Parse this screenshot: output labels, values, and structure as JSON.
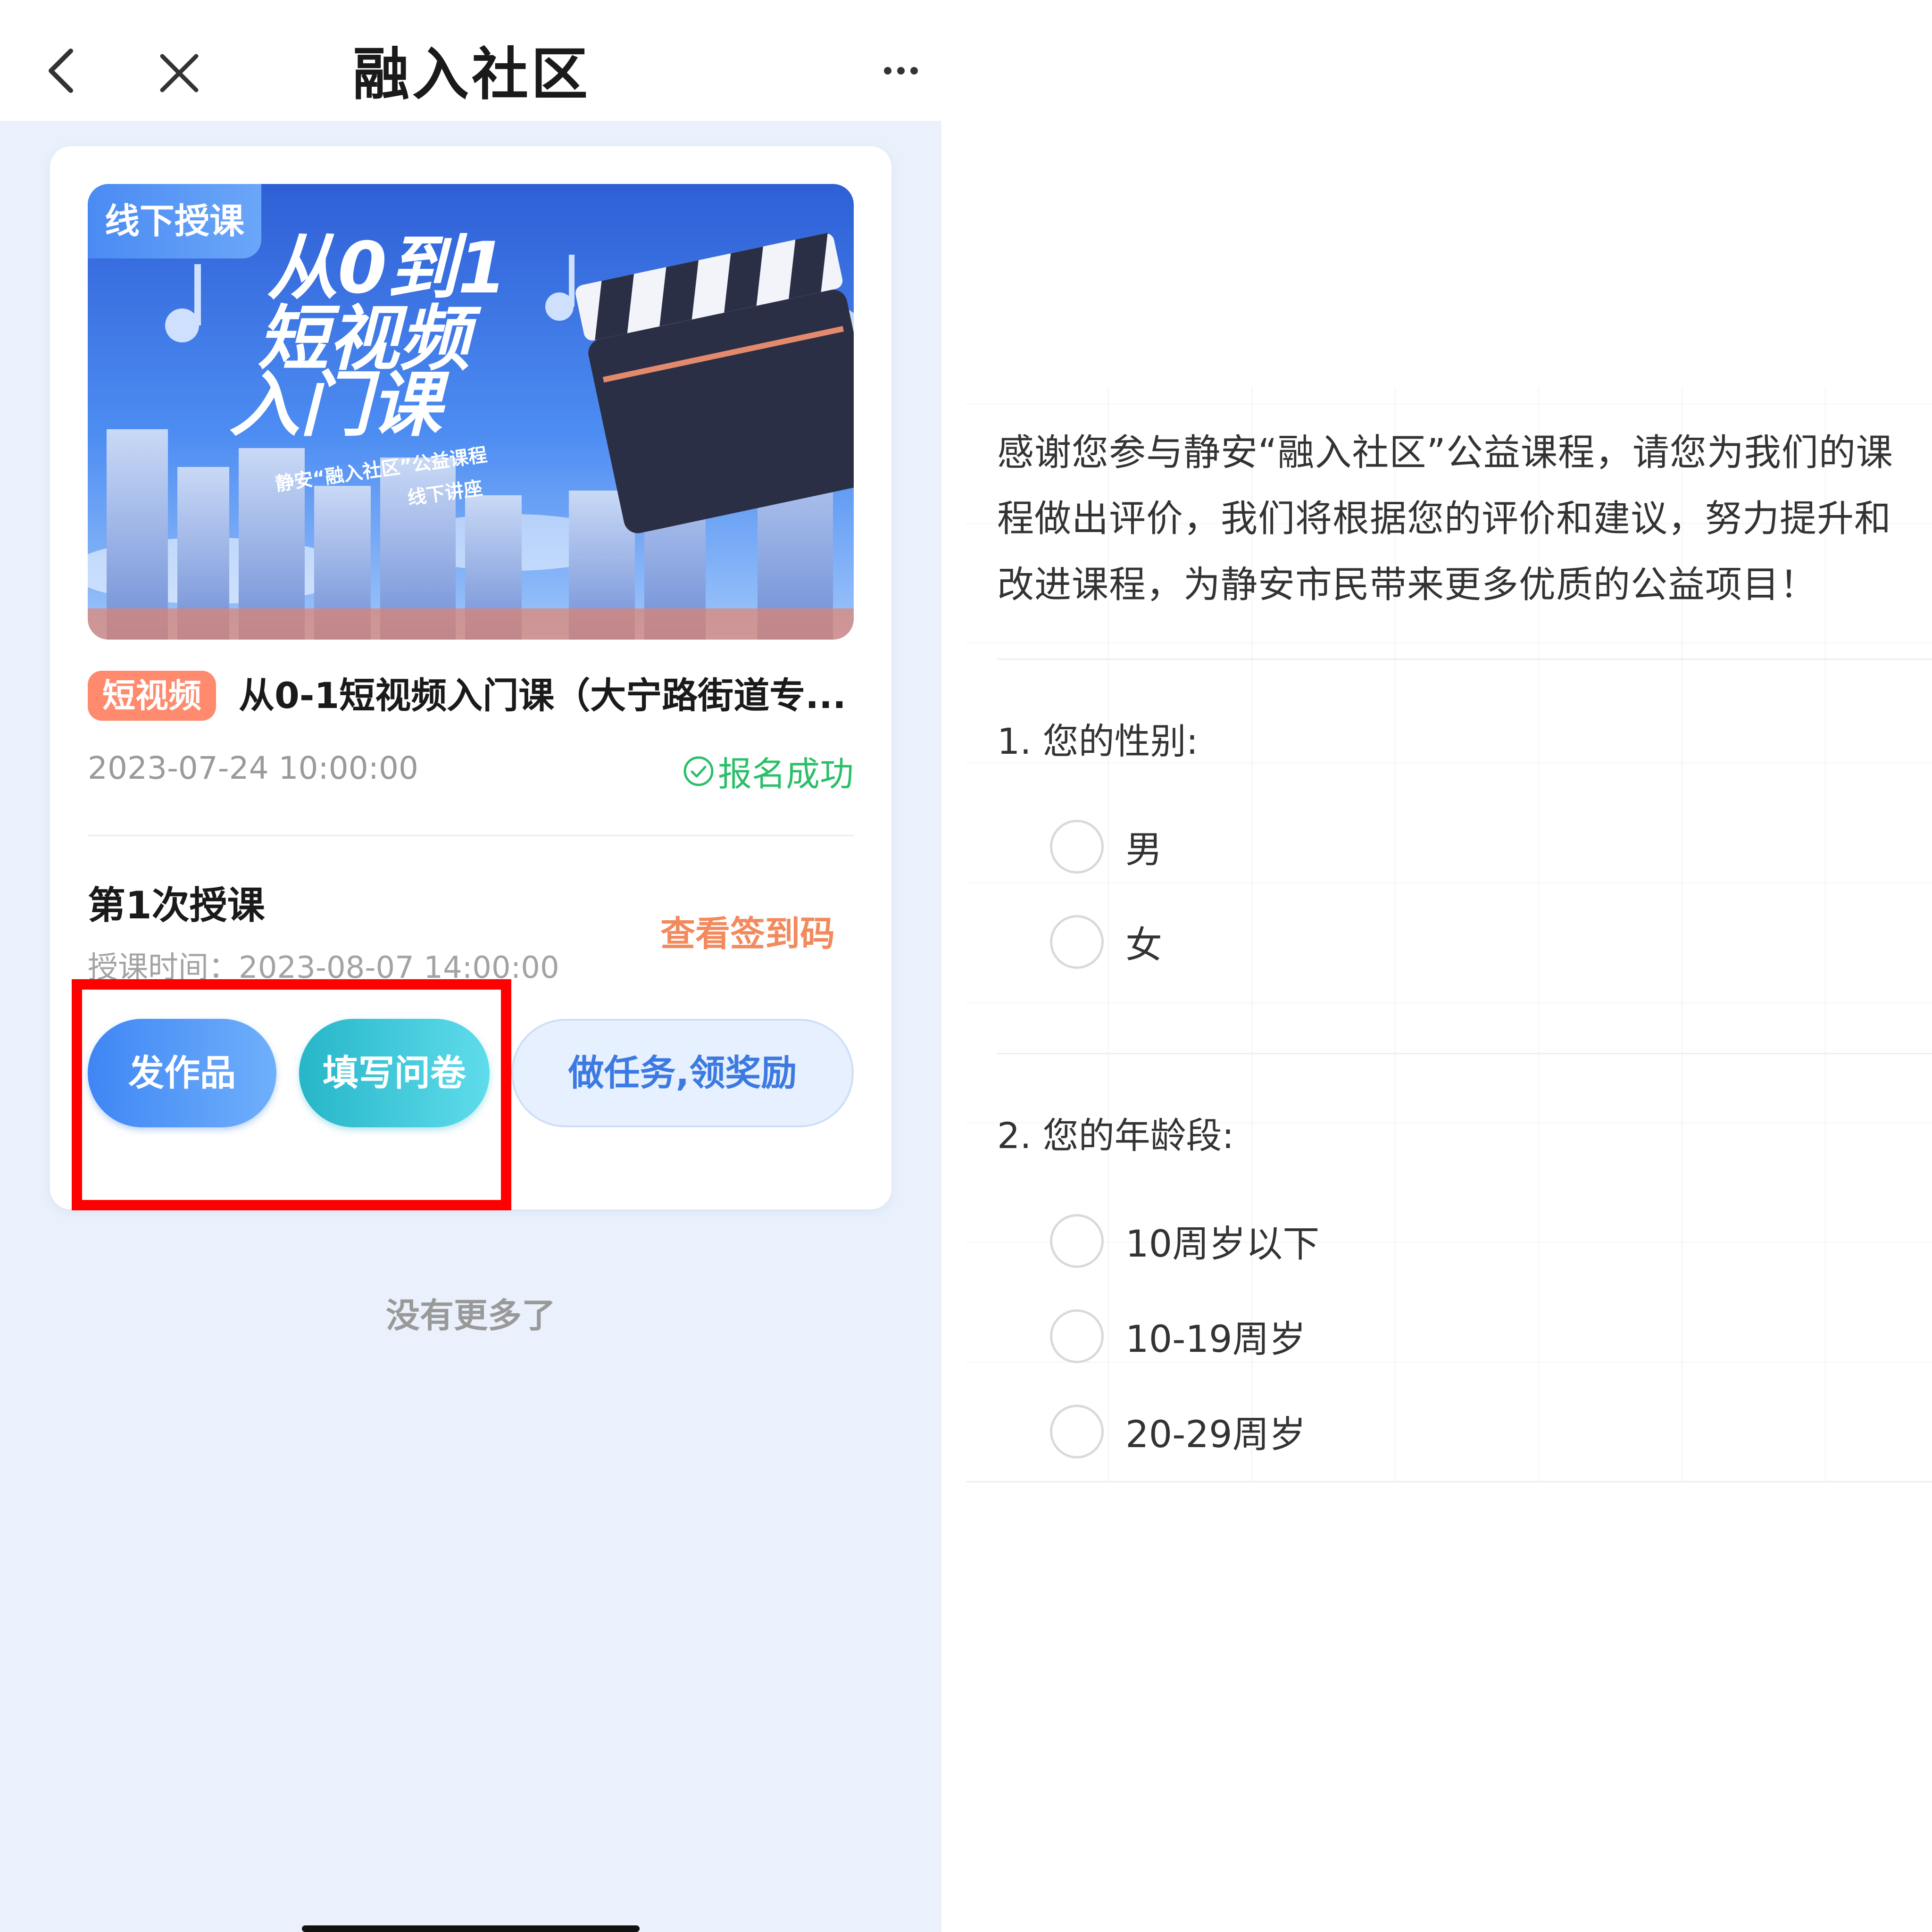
{
  "nav": {
    "title": "融入社区"
  },
  "card": {
    "banner_tag": "线下授课",
    "banner_headline": "从0到1短视频入门课",
    "banner_subtitle_line1": "静安“融入社区”公益课程",
    "banner_subtitle_line2": "线下讲座",
    "category_tag": "短视频",
    "course_title": "从0-1短视频入门课（大宁路街道专...",
    "date": "2023-07-24 10:00:00",
    "status": "报名成功",
    "session_title": "第1次授课",
    "session_time": "授课时间：2023-08-07 14:00:00",
    "checkin_link": "查看签到码",
    "buttons": {
      "works": "发作品",
      "survey": "填写问卷",
      "task": "做任务,领奖励"
    }
  },
  "no_more": "没有更多了",
  "survey": {
    "intro": "感谢您参与静安“融入社区”公益课程，请您为我们的课程做出评价，我们将根据您的评价和建议，努力提升和改进课程，为静安市民带来更多优质的公益项目！",
    "questions": [
      {
        "title": "1. 您的性别:",
        "options": [
          "男",
          "女"
        ]
      },
      {
        "title": "2. 您的年龄段:",
        "options": [
          "10周岁以下",
          "10-19周岁",
          "20-29周岁"
        ]
      }
    ]
  },
  "colors": {
    "page_bg": "#eaf1fc",
    "status_green": "#2bbf6a",
    "accent_orange": "#f28a5e",
    "highlight_red": "#ff0000",
    "button_blue": "#3f86f5",
    "button_teal": "#26b6c8"
  },
  "icons": [
    "back-arrow-icon",
    "close-icon",
    "more-icon",
    "check-circle-icon",
    "radio-icon"
  ]
}
